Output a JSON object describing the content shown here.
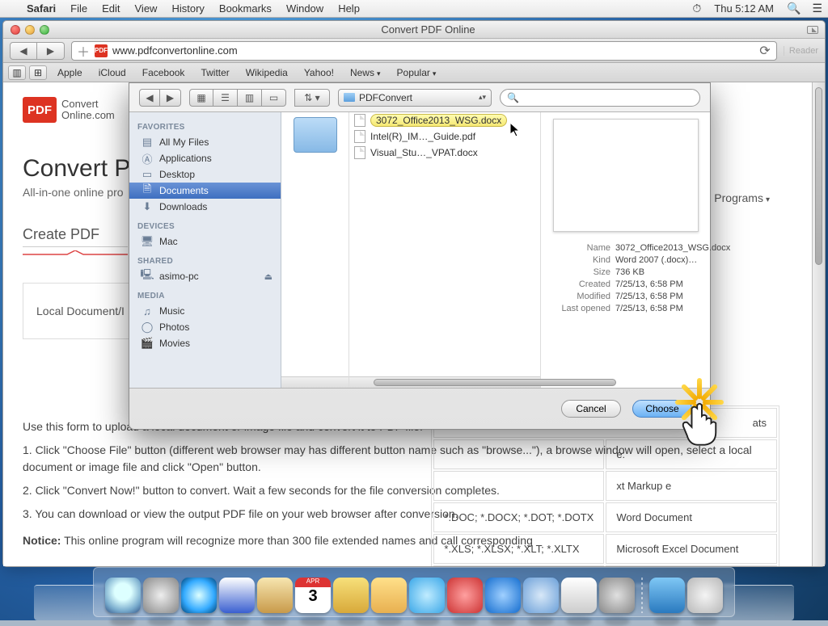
{
  "menubar": {
    "app": "Safari",
    "items": [
      "File",
      "Edit",
      "View",
      "History",
      "Bookmarks",
      "Window",
      "Help"
    ],
    "clock": "Thu 5:12 AM"
  },
  "window": {
    "title": "Convert PDF Online",
    "reader": "Reader"
  },
  "url": "www.pdfconvertonline.com",
  "bookmarks": [
    "Apple",
    "iCloud",
    "Facebook",
    "Twitter",
    "Wikipedia",
    "Yahoo!",
    "News",
    "Popular"
  ],
  "brand": {
    "box": "PDF",
    "line1": "Convert",
    "line2": "Online.com"
  },
  "onlinePrograms": "nline Programs",
  "page": {
    "h1": "Convert PD",
    "sub": "All-in-one online pro",
    "tab": "Create PDF",
    "uploadCell": "Local Document/I",
    "convert": "Convert Now!",
    "desc": "Use this form to upload a local document or image file and convert it to PDF file.",
    "i1": "1. Click \"Choose File\" button (different web browser may has different button name such as \"browse...\"), a browse window will open, select a local document or image file and click \"Open\" button.",
    "i2": "2. Click \"Convert Now!\" button to convert. Wait a few seconds for the file conversion completes.",
    "i3": "3. You can download or view the output PDF file on your web browser after conversion.",
    "noticeLabel": "Notice:",
    "notice": " This online program will recognize more than 300 file extended names and call corresponding"
  },
  "formats": {
    "headerRight": "ats",
    "rows": [
      {
        "a": "",
        "b": "e:"
      },
      {
        "a": "",
        "b": "xt Markup e"
      },
      {
        "a": "*.DOC; *.DOCX; *.DOT; *.DOTX",
        "b": "Word Document"
      },
      {
        "a": "*.XLS; *.XLSX; *.XLT; *.XLTX",
        "b": "Microsoft Excel Document"
      },
      {
        "a": "*.PPT; *.POT",
        "b": "Microsoft PowerPoint Document"
      }
    ]
  },
  "dialog": {
    "folder": "PDFConvert",
    "searchPlaceholder": "",
    "sidebar": {
      "favorites": "Favorites",
      "items_fav": [
        "All My Files",
        "Applications",
        "Desktop",
        "Documents",
        "Downloads"
      ],
      "devices": "Devices",
      "items_dev": [
        "Mac"
      ],
      "shared": "Shared",
      "items_shr": [
        "asimo-pc"
      ],
      "media": "Media",
      "items_med": [
        "Music",
        "Photos",
        "Movies"
      ]
    },
    "files": {
      "f0": "3072_Office2013_WSG.docx",
      "f1": "Intel(R)_IM…_Guide.pdf",
      "f2": "Visual_Stu…_VPAT.docx"
    },
    "meta": {
      "kName": "Name",
      "vName": "3072_Office2013_WSG.docx",
      "kKind": "Kind",
      "vKind": "Word 2007 (.docx)…",
      "kSize": "Size",
      "vSize": "736 KB",
      "kCreated": "Created",
      "vCreated": "7/25/13, 6:58 PM",
      "kModified": "Modified",
      "vModified": "7/25/13, 6:58 PM",
      "kOpened": "Last opened",
      "vOpened": "7/25/13, 6:58 PM"
    },
    "cancel": "Cancel",
    "choose": "Choose"
  }
}
